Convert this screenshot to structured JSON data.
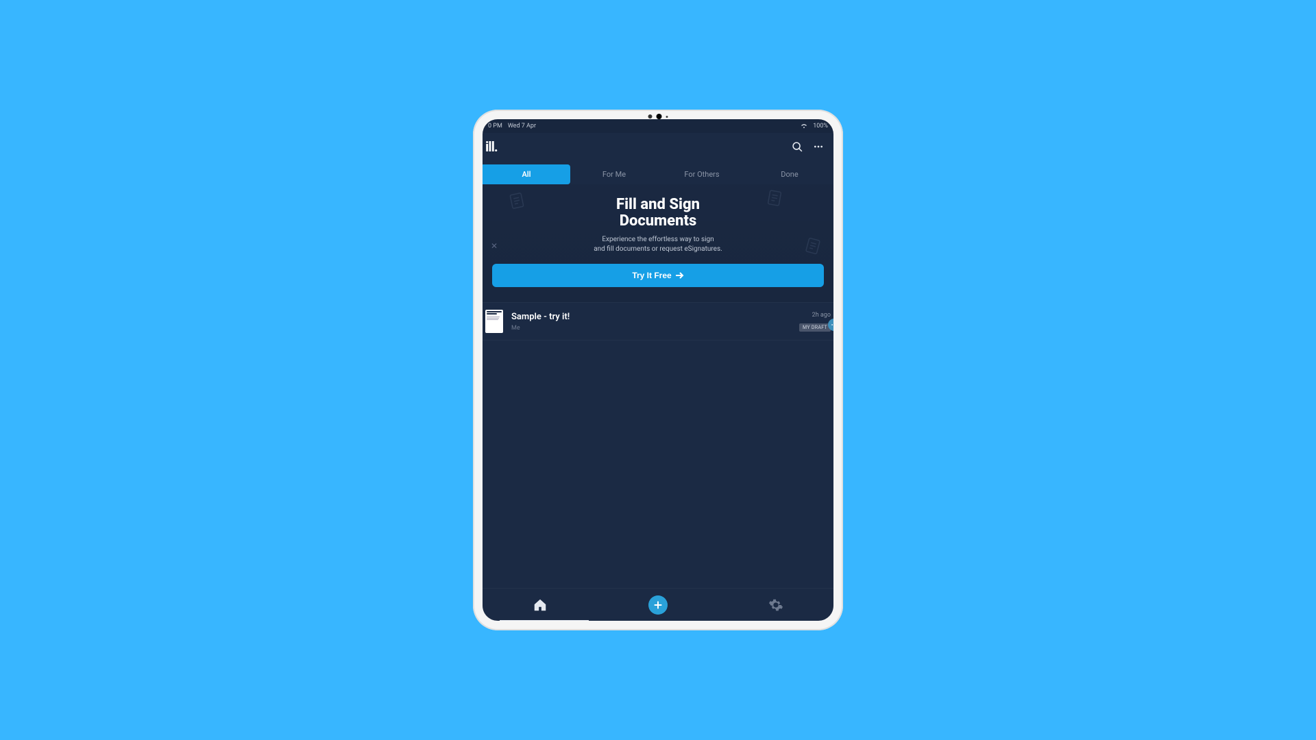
{
  "status_bar": {
    "time": "0 PM",
    "date": "Wed 7 Apr",
    "battery": "100%"
  },
  "header": {
    "logo": "ill."
  },
  "tabs": [
    {
      "label": "All",
      "active": true
    },
    {
      "label": "For Me",
      "active": false
    },
    {
      "label": "For Others",
      "active": false
    },
    {
      "label": "Done",
      "active": false
    }
  ],
  "hero": {
    "title_line1": "Fill and Sign",
    "title_line2": "Documents",
    "subtitle_line1": "Experience the effortless way to sign",
    "subtitle_line2": "and fill documents or request eSignatures.",
    "cta_label": "Try It Free"
  },
  "documents": [
    {
      "title": "Sample - try it!",
      "owner": "Me",
      "time": "2h ago",
      "badge": "MY DRAFT"
    }
  ]
}
